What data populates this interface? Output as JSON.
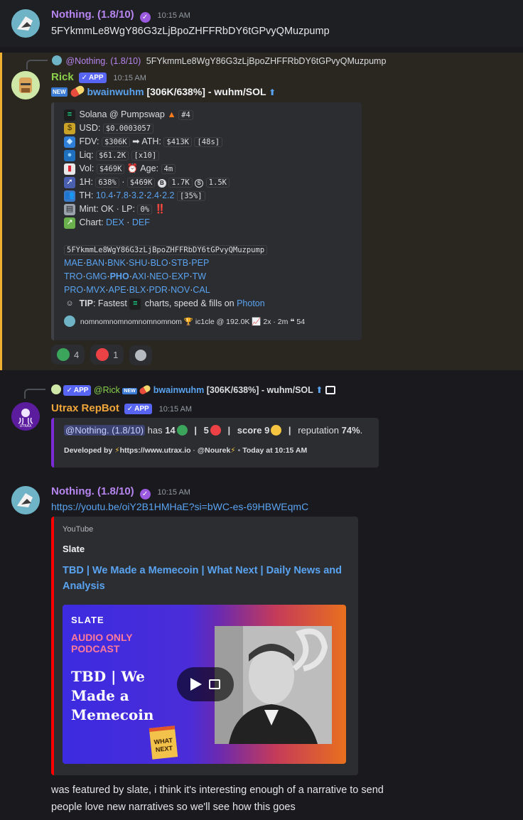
{
  "colors": {
    "app_bg": "#1a1a1e",
    "username_nothing": "#b685f0",
    "username_rick": "#8bd14b",
    "username_utrax": "#f0a53a",
    "link": "#5aa3f0",
    "highlight_bar": "#f0b132",
    "youtube_red": "#ff0000",
    "utrax_purple": "#7b2bd6"
  },
  "msg1": {
    "username": "Nothing. (1.8/10)",
    "time": "10:15 AM",
    "text": "5FYkmmLe8WgY86G3zLjBpoZHFFRbDY6tGPvyQMuzpump"
  },
  "msg2": {
    "reply": {
      "username": "@Nothing. (1.8/10)",
      "text": "5FYkmmLe8WgY86G3zLjBpoZHFFRbDY6tGPvyQMuzpump"
    },
    "username": "Rick",
    "app_badge": "APP",
    "time": "10:15 AM",
    "title": {
      "new_tag": "NEW",
      "token": "bwainwuhm",
      "rest": "[306K/638%] - wuhm/SOL",
      "arrow": "⬆"
    },
    "embed": {
      "pair": "Solana @ Pumpswap",
      "rank": "#4",
      "usd_label": "USD:",
      "usd": "$0.0003057",
      "fdv_label": "FDV:",
      "fdv": "$306K",
      "ath_label": "ATH:",
      "ath": "$413K",
      "ath_age": "[48s]",
      "liq_label": "Liq:",
      "liq": "$61.2K",
      "liq_mult": "[x10]",
      "vol_label": "Vol:",
      "vol": "$469K",
      "age_label": "Age:",
      "age": "4m",
      "h1_label": "1H:",
      "h1_pct": "638%",
      "h1_vol": "$469K",
      "buys": "1.7K",
      "sells": "1.5K",
      "th_label": "TH:",
      "th_values": [
        "10.4",
        "7.8",
        "3.2",
        "2.4",
        "2.2"
      ],
      "th_total": "[35%]",
      "mint_text": "Mint: OK · LP:",
      "lp": "0%",
      "lp_warn": "‼️",
      "chart_label": "Chart:",
      "chart_links": [
        "DEX",
        "DEF"
      ],
      "ca": "5FYkmmLe8WgY86G3zLjBpoZHFFRbDY6tGPvyQMuzpump",
      "link_rows": [
        [
          "MAE",
          "BAN",
          "BNK",
          "SHU",
          "BLO",
          "STB",
          "PEP"
        ],
        [
          "TRO",
          "GMG",
          "PHO",
          "AXI",
          "NEO",
          "EXP",
          "TW"
        ],
        [
          "PRO",
          "MVX",
          "APE",
          "BLX",
          "PDR",
          "NOV",
          "CAL"
        ]
      ],
      "tip_label": "TIP",
      "tip_text": ": Fastest",
      "tip_text2": "charts, speed & fills on",
      "tip_link": "Photon",
      "footer": {
        "name": "nomnomnomnomnomnomnom",
        "user": "ic1cle @ 192.0K",
        "stats": "2x · 2m",
        "count": "54"
      }
    },
    "reactions": [
      {
        "color": "#3ba55c",
        "count": "4"
      },
      {
        "color": "#ed4245",
        "count": "1"
      }
    ]
  },
  "msg3": {
    "reply": {
      "app_badge": "APP",
      "username": "@Rick",
      "new_tag": "NEW",
      "token": "bwainwuhm",
      "rest": "[306K/638%] - wuhm/SOL",
      "arrow": "⬆"
    },
    "username": "Utrax RepBot",
    "app_badge": "APP",
    "time": "10:15 AM",
    "embed": {
      "mention": "@Nothing. (1.8/10)",
      "has": "has",
      "pos": "14",
      "neg": "5",
      "score_label": "score",
      "score": "9",
      "rep_label": "reputation",
      "rep": "74%",
      "dev_label": "Developed by",
      "dev_url": "https://www.utrax.io",
      "dev_user": "@Nourek",
      "dev_time": "Today at 10:15 AM"
    }
  },
  "msg4": {
    "username": "Nothing. (1.8/10)",
    "time": "10:15 AM",
    "link": "https://youtu.be/oiY2B1HMHaE?si=bWC-es-69HBWEqmC",
    "embed": {
      "provider": "YouTube",
      "author": "Slate",
      "title_line1": "TBD | We Made a Memecoin | What Next | Daily News and",
      "title_line2": "Analysis",
      "thumb": {
        "brand": "SLATE",
        "tag1": "AUDIO ONLY",
        "tag2": "PODCAST",
        "title1": "TBD | We",
        "title2": "Made a",
        "title3": "Memecoin",
        "stamp1": "WHAT",
        "stamp2": "NEXT"
      }
    },
    "lines": [
      "was featured by slate, i think it's interesting enough of a narrative to send",
      "people love new narratives so we'll see how this goes"
    ]
  }
}
